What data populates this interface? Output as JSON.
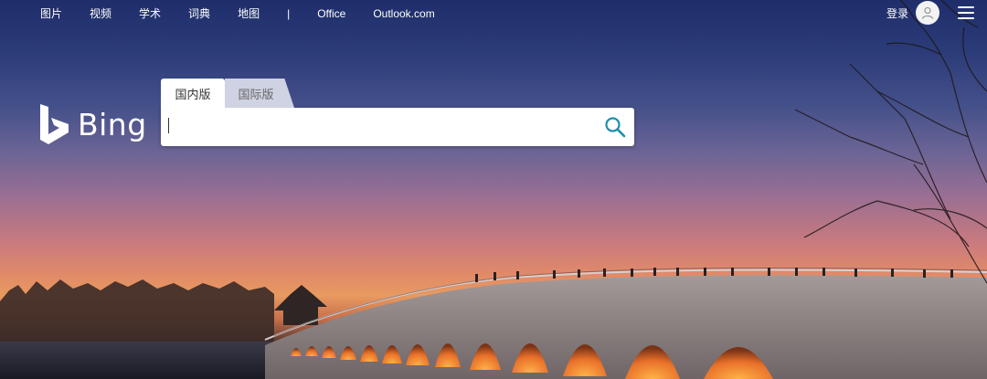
{
  "nav": {
    "links": [
      "图片",
      "视频",
      "学术",
      "词典",
      "地图"
    ],
    "separator": "|",
    "extra_links": [
      "Office",
      "Outlook.com"
    ]
  },
  "header": {
    "signin_label": "登录",
    "menu_icon": "hamburger-menu-icon",
    "avatar_icon": "user-avatar-icon"
  },
  "logo": {
    "text": "Bing",
    "icon": "bing-logo-icon"
  },
  "search": {
    "tabs": [
      {
        "label": "国内版",
        "active": true
      },
      {
        "label": "国际版",
        "active": false
      }
    ],
    "value": "",
    "icon": "search-icon",
    "accent_color": "#1b8fa8"
  },
  "background": {
    "image_subject": "seventeen-arch-bridge-sunset-icon"
  }
}
